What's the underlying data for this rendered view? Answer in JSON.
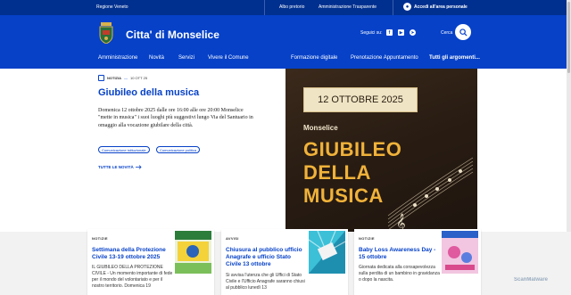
{
  "topbar": {
    "region": "Regione Veneto",
    "links": [
      "Albo pretorio",
      "Amministrazione Trasparente"
    ],
    "login": "Accedi all'area personale"
  },
  "header": {
    "site_title": "Citta' di Monselice",
    "follow_label": "Seguici su:",
    "social": [
      "facebook-icon",
      "youtube-icon",
      "telegram-icon"
    ],
    "search_label": "Cerca"
  },
  "nav": {
    "left": [
      "Amministrazione",
      "Novità",
      "Servizi",
      "Vivere il Comune"
    ],
    "right": [
      "Formazione digitale",
      "Prenotazione Appuntamento"
    ],
    "all": "Tutti gli argomenti..."
  },
  "hero": {
    "category": "NOTIZIA",
    "date": "10 OTT 25",
    "title": "Giubileo della musica",
    "description": "Domenica 12 ottobre 2025 dalle ore 16:00 alle ore 20:00 Monselice \"mette in musica\" i suoi luoghi più suggestivi lungo Via del Santuario in omaggio alla vocazione giubilare della città.",
    "chips": [
      "Comunicazione istituzionale",
      "Comunicazione politica"
    ],
    "all_news": "TUTTE LE NOVITÀ",
    "image": {
      "date": "12 OTTOBRE 2025",
      "city": "Monselice",
      "lines": [
        "GIUBILEO",
        "DELLA",
        "MUSICA"
      ]
    }
  },
  "cards": [
    {
      "category": "NOTIZIE",
      "title": "Settimana della Protezione Civile 13-19 ottobre 2025",
      "text": "IL GIUBILEO DELLA PROTEZIONE CIVILE - Un momento importante di fede per il mondo del volontariato e per il nostro territorio. Domenica 19"
    },
    {
      "category": "AVVISI",
      "title": "Chiusura al pubblico ufficio Anagrafe e ufficio Stato Civile 13 ottobre",
      "text": "Si avvisa l'utenza che gli Uffici di Stato Civile e l'Ufficio Anagrafe saranno chiusi al pubblico lunedì 13"
    },
    {
      "category": "NOTIZIE",
      "title": "Baby Loss Awareness Day - 15 ottobre",
      "text": "Giornata dedicata alla consapevolezza sulla perdita di un bambino in gravidanza o dopo la nascita."
    }
  ],
  "watermark": "ScanMalware",
  "colors": {
    "primary": "#0641c8",
    "topbar": "#00308f",
    "hero_image_bg": "#2a1d13",
    "hero_image_text": "#f0b23a"
  }
}
